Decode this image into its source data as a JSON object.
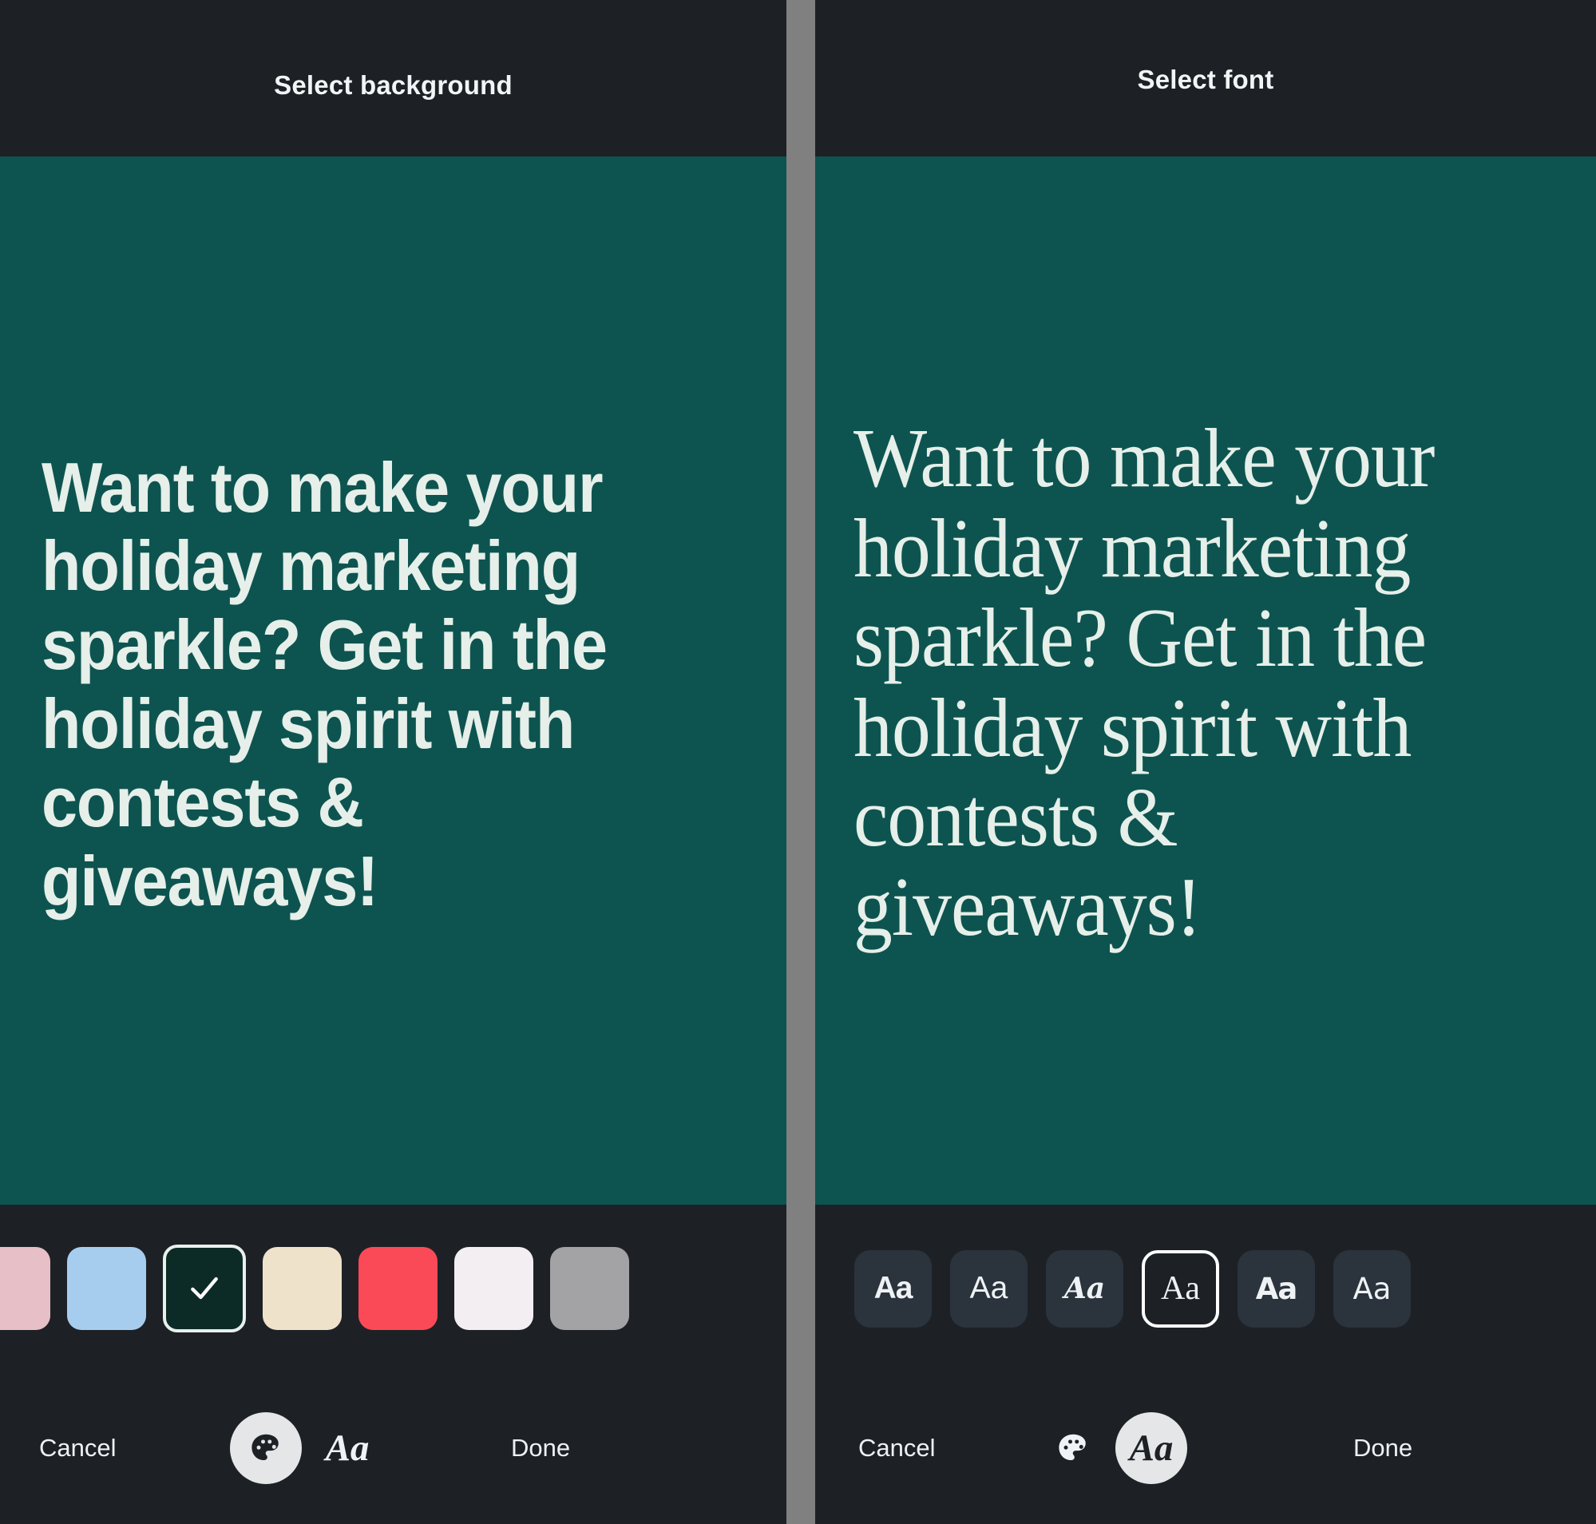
{
  "panels": {
    "left": {
      "title": "Select background",
      "canvas": {
        "background_color": "#0d5450",
        "text_color": "#e6efe9",
        "headline": "Want to make your holiday marketing sparkle? Get in the holiday spirit with contests & giveaways!"
      },
      "swatches": [
        {
          "name": "swatch-pink",
          "color": "#e7bfc6",
          "selected": false,
          "partial": true
        },
        {
          "name": "swatch-blue",
          "color": "#a7cdee",
          "selected": false,
          "partial": false
        },
        {
          "name": "swatch-dark-green",
          "color": "#0c2b26",
          "selected": true,
          "partial": false
        },
        {
          "name": "swatch-cream",
          "color": "#eee2ca",
          "selected": false,
          "partial": false
        },
        {
          "name": "swatch-red",
          "color": "#fb4a57",
          "selected": false,
          "partial": false
        },
        {
          "name": "swatch-white",
          "color": "#f2eef1",
          "selected": false,
          "partial": false
        },
        {
          "name": "swatch-gray",
          "color": "#a3a2a5",
          "selected": false,
          "partial": true
        }
      ],
      "bottom_bar": {
        "cancel_label": "Cancel",
        "done_label": "Done",
        "palette_active": true,
        "font_active": false,
        "font_glyph": "Aa"
      }
    },
    "right": {
      "title": "Select font",
      "canvas": {
        "background_color": "#0d5450",
        "text_color": "#e6efe9",
        "headline": "Want to make your holiday marketing sparkle? Get in the holiday spirit with contests & giveaways!"
      },
      "font_tiles": [
        {
          "name": "font-tile-bold-sans",
          "glyph": "Aa",
          "selected": false
        },
        {
          "name": "font-tile-light-sans",
          "glyph": "Aa",
          "selected": false
        },
        {
          "name": "font-tile-script",
          "glyph": "Aa",
          "selected": false
        },
        {
          "name": "font-tile-serif",
          "glyph": "Aa",
          "selected": true
        },
        {
          "name": "font-tile-heavy-sans",
          "glyph": "Aa",
          "selected": false
        },
        {
          "name": "font-tile-geometric",
          "glyph": "Aa",
          "selected": false
        }
      ],
      "bottom_bar": {
        "cancel_label": "Cancel",
        "done_label": "Done",
        "palette_active": false,
        "font_active": true,
        "font_glyph": "Aa"
      }
    }
  },
  "theme": {
    "chrome_color": "#1d2126",
    "divider_color": "#808080",
    "tile_color": "#2b333c",
    "accent_white": "#ffffff"
  },
  "icons": {
    "check": "check-icon",
    "palette": "palette-icon"
  }
}
